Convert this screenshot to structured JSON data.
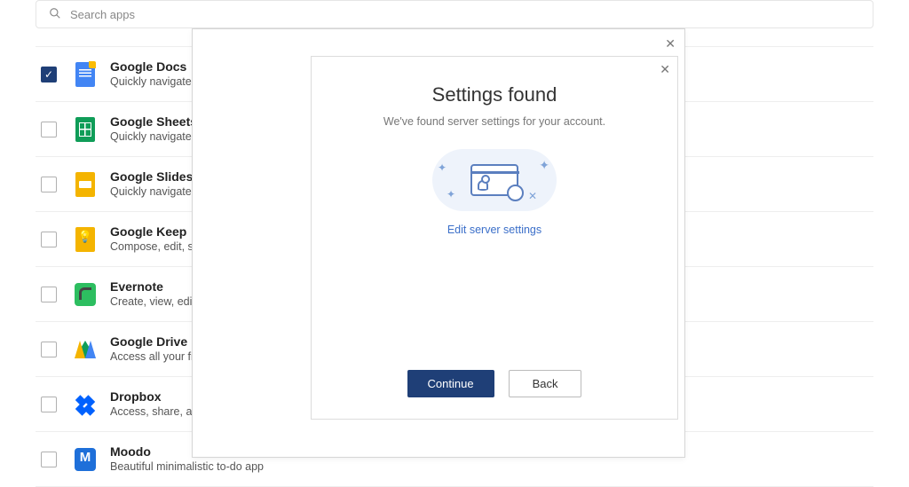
{
  "search": {
    "placeholder": "Search apps"
  },
  "apps": [
    {
      "name": "Google Docs",
      "desc": "Quickly navigate to your Google Docs",
      "checked": true
    },
    {
      "name": "Google Sheets",
      "desc": "Quickly navigate to your Google Sheets",
      "checked": false
    },
    {
      "name": "Google Slides",
      "desc": "Quickly navigate to your Google Slides",
      "checked": false
    },
    {
      "name": "Google Keep",
      "desc": "Compose, edit, share notes",
      "checked": false
    },
    {
      "name": "Evernote",
      "desc": "Create, view, edit notes",
      "checked": false
    },
    {
      "name": "Google Drive",
      "desc": "Access all your files in Drive",
      "checked": false
    },
    {
      "name": "Dropbox",
      "desc": "Access, share, and organize files",
      "checked": false
    },
    {
      "name": "Moodo",
      "desc": "Beautiful minimalistic to-do app",
      "checked": false
    }
  ],
  "modal": {
    "title": "Settings found",
    "subtitle": "We've found server settings for your account.",
    "link": "Edit server settings",
    "continue": "Continue",
    "back": "Back",
    "close": "✕"
  }
}
